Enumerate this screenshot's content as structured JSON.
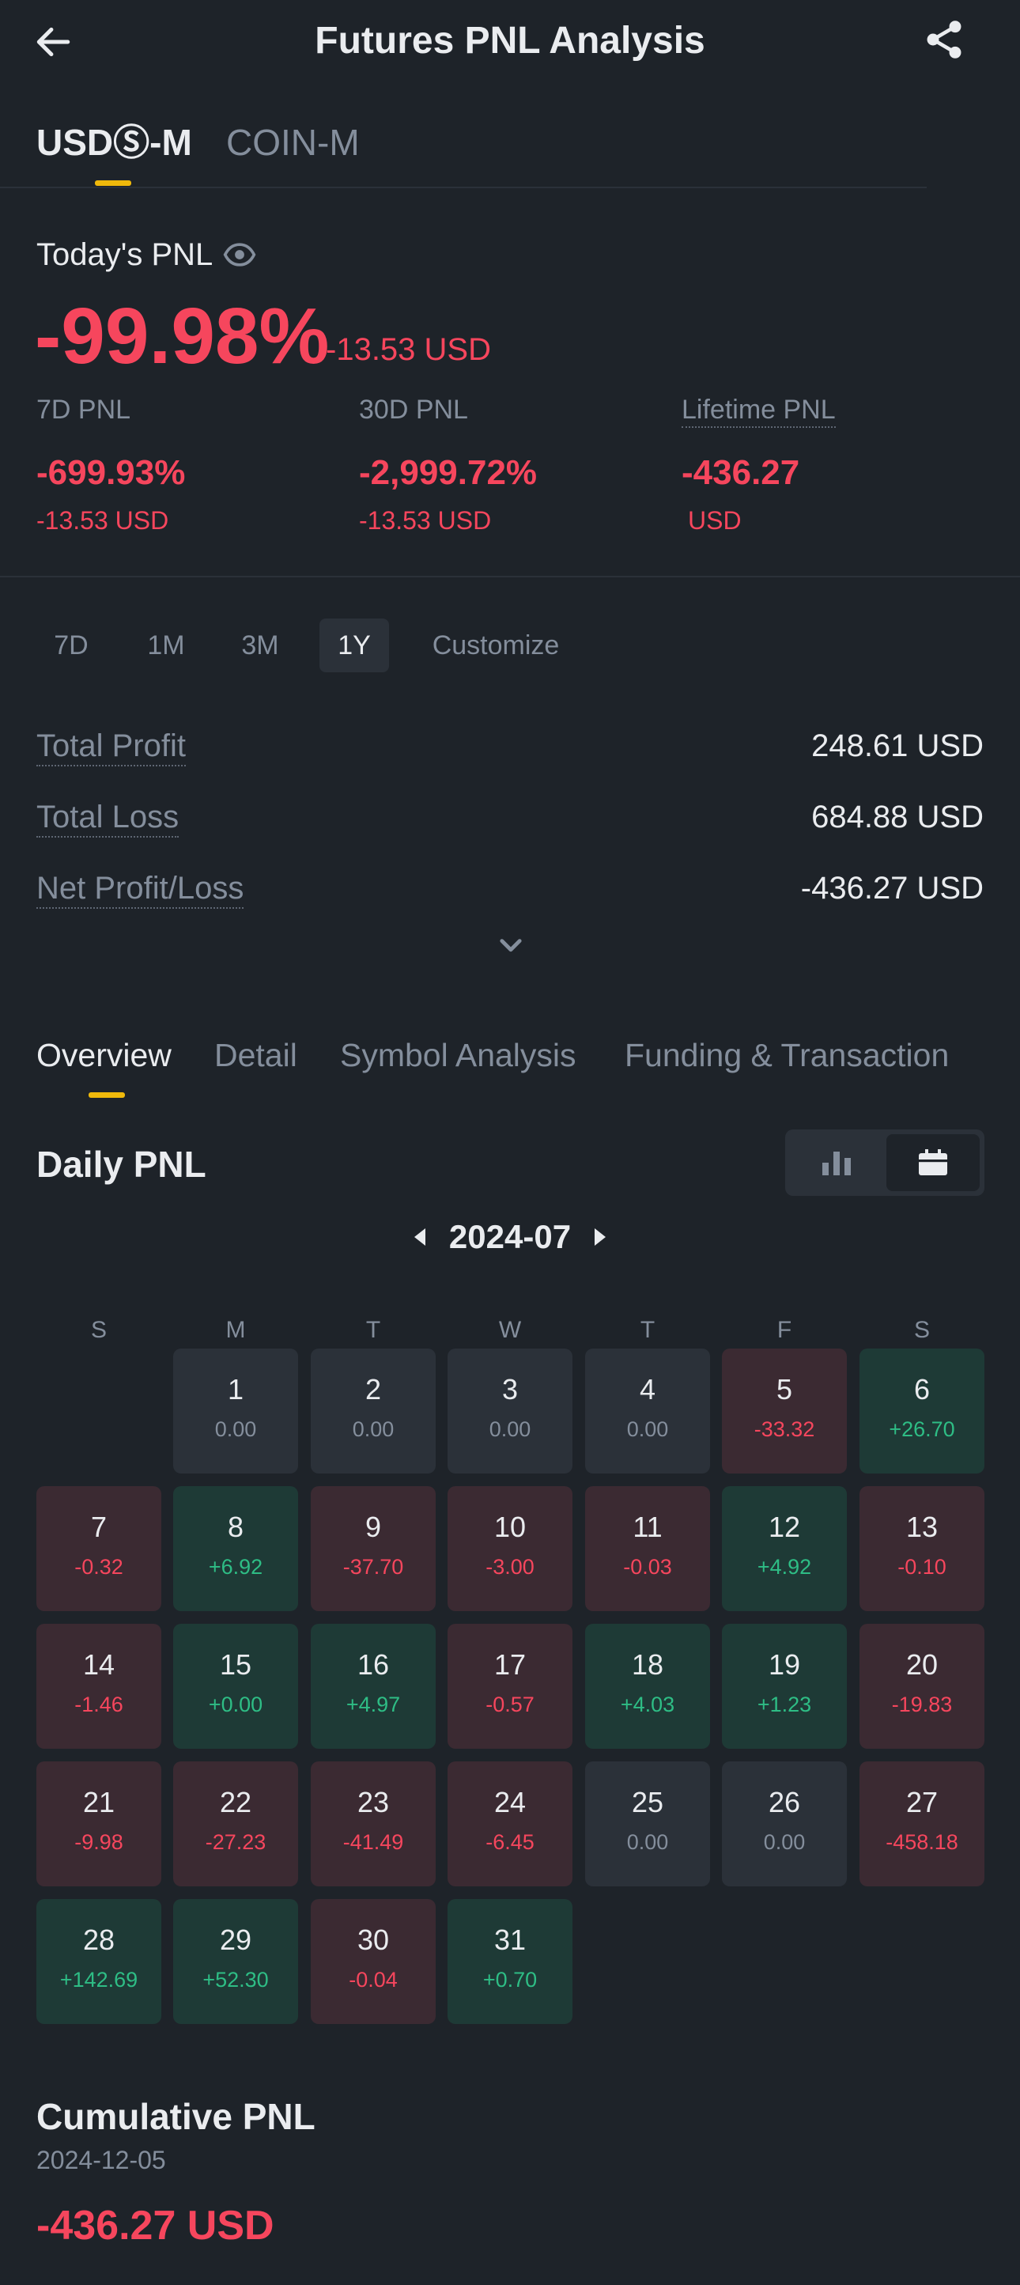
{
  "header": {
    "title": "Futures PNL Analysis",
    "back_icon": "back-arrow-icon",
    "share_icon": "share-icon"
  },
  "market_tabs": [
    {
      "label": "USDⓈ-M",
      "active": true
    },
    {
      "label": "COIN-M",
      "active": false
    }
  ],
  "today": {
    "label": "Today's PNL",
    "eye_icon": "eye-icon",
    "percent": "-99.98%",
    "usd": "-13.53 USD"
  },
  "stats": {
    "d7": {
      "label": "7D PNL",
      "value": "-699.93%",
      "sub": "-13.53 USD"
    },
    "d30": {
      "label": "30D PNL",
      "value": "-2,999.72%",
      "sub": "-13.53 USD"
    },
    "lifetime": {
      "label": "Lifetime PNL",
      "value": "-436.27",
      "sub": "USD"
    }
  },
  "period_tabs": [
    {
      "label": "7D",
      "active": false
    },
    {
      "label": "1M",
      "active": false
    },
    {
      "label": "3M",
      "active": false
    },
    {
      "label": "1Y",
      "active": true
    },
    {
      "label": "Customize",
      "active": false
    }
  ],
  "summary": {
    "total_profit": {
      "label": "Total Profit",
      "value": "248.61 USD"
    },
    "total_loss": {
      "label": "Total Loss",
      "value": "684.88 USD"
    },
    "net": {
      "label": "Net Profit/Loss",
      "value": "-436.27 USD"
    }
  },
  "section_tabs": [
    {
      "label": "Overview",
      "active": true
    },
    {
      "label": "Detail",
      "active": false
    },
    {
      "label": "Symbol Analysis",
      "active": false
    },
    {
      "label": "Funding & Transaction",
      "active": false
    }
  ],
  "daily_pnl": {
    "title": "Daily PNL",
    "view_icons": [
      "bar-chart-icon",
      "calendar-icon"
    ],
    "active_view": "calendar",
    "month": "2024-07",
    "weekdays": [
      "S",
      "M",
      "T",
      "W",
      "T",
      "F",
      "S"
    ],
    "first_weekday_index": 1,
    "days": [
      {
        "day": "1",
        "pnl": "0.00",
        "kind": "neutral"
      },
      {
        "day": "2",
        "pnl": "0.00",
        "kind": "neutral"
      },
      {
        "day": "3",
        "pnl": "0.00",
        "kind": "neutral"
      },
      {
        "day": "4",
        "pnl": "0.00",
        "kind": "neutral"
      },
      {
        "day": "5",
        "pnl": "-33.32",
        "kind": "loss"
      },
      {
        "day": "6",
        "pnl": "+26.70",
        "kind": "gain"
      },
      {
        "day": "7",
        "pnl": "-0.32",
        "kind": "loss"
      },
      {
        "day": "8",
        "pnl": "+6.92",
        "kind": "gain"
      },
      {
        "day": "9",
        "pnl": "-37.70",
        "kind": "loss"
      },
      {
        "day": "10",
        "pnl": "-3.00",
        "kind": "loss"
      },
      {
        "day": "11",
        "pnl": "-0.03",
        "kind": "loss"
      },
      {
        "day": "12",
        "pnl": "+4.92",
        "kind": "gain"
      },
      {
        "day": "13",
        "pnl": "-0.10",
        "kind": "loss"
      },
      {
        "day": "14",
        "pnl": "-1.46",
        "kind": "loss"
      },
      {
        "day": "15",
        "pnl": "+0.00",
        "kind": "gain"
      },
      {
        "day": "16",
        "pnl": "+4.97",
        "kind": "gain"
      },
      {
        "day": "17",
        "pnl": "-0.57",
        "kind": "loss"
      },
      {
        "day": "18",
        "pnl": "+4.03",
        "kind": "gain"
      },
      {
        "day": "19",
        "pnl": "+1.23",
        "kind": "gain"
      },
      {
        "day": "20",
        "pnl": "-19.83",
        "kind": "loss"
      },
      {
        "day": "21",
        "pnl": "-9.98",
        "kind": "loss"
      },
      {
        "day": "22",
        "pnl": "-27.23",
        "kind": "loss"
      },
      {
        "day": "23",
        "pnl": "-41.49",
        "kind": "loss"
      },
      {
        "day": "24",
        "pnl": "-6.45",
        "kind": "loss"
      },
      {
        "day": "25",
        "pnl": "0.00",
        "kind": "neutral"
      },
      {
        "day": "26",
        "pnl": "0.00",
        "kind": "neutral"
      },
      {
        "day": "27",
        "pnl": "-458.18",
        "kind": "loss"
      },
      {
        "day": "28",
        "pnl": "+142.69",
        "kind": "gain"
      },
      {
        "day": "29",
        "pnl": "+52.30",
        "kind": "gain"
      },
      {
        "day": "30",
        "pnl": "-0.04",
        "kind": "loss"
      },
      {
        "day": "31",
        "pnl": "+0.70",
        "kind": "gain"
      }
    ]
  },
  "cumulative": {
    "title": "Cumulative PNL",
    "date": "2024-12-05",
    "value": "-436.27 USD"
  },
  "colors": {
    "background": "#1e2329",
    "accent": "#f0b90b",
    "loss": "#f6465d",
    "gain": "#2ebd85"
  }
}
